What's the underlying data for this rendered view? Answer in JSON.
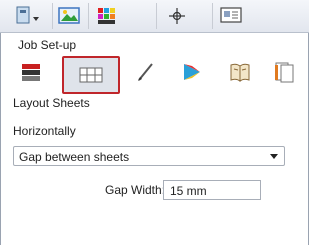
{
  "toolbar": {
    "buttons": [
      {
        "name": "document-menu",
        "icon": "document-dropdown-icon"
      },
      {
        "name": "image",
        "icon": "image-icon"
      },
      {
        "name": "color-swatches",
        "icon": "swatches-icon"
      },
      {
        "name": "registration",
        "icon": "crosshair-icon"
      },
      {
        "name": "screen",
        "icon": "monitor-icon"
      }
    ]
  },
  "section": {
    "title": "Job Set-up",
    "tools": [
      {
        "name": "stack",
        "icon": "stack-icon"
      },
      {
        "name": "layout-sheets",
        "icon": "layout-sheets-icon",
        "selected": true
      },
      {
        "name": "marks",
        "icon": "pen-icon"
      },
      {
        "name": "color",
        "icon": "color-wheel-icon"
      },
      {
        "name": "book",
        "icon": "book-icon"
      },
      {
        "name": "pages",
        "icon": "pages-icon"
      }
    ]
  },
  "layout": {
    "heading": "Layout Sheets",
    "orientation_label": "Horizontally",
    "gap_select": {
      "value": "Gap between sheets"
    },
    "gap_width_label": "Gap Width:",
    "gap_width_value": "15 mm"
  },
  "colors": {
    "selection_border": "#c0262b"
  }
}
